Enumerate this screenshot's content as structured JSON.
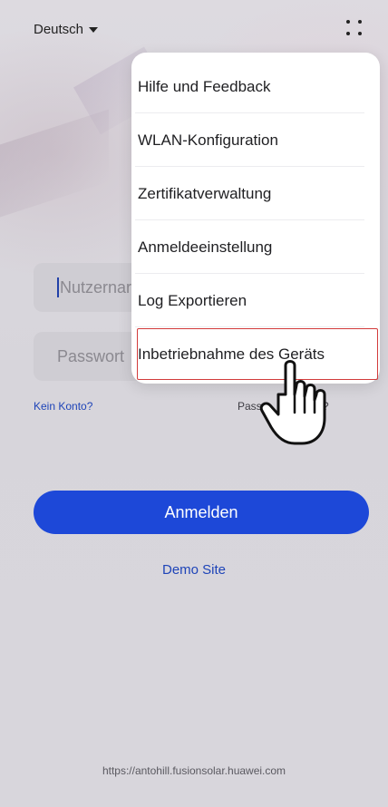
{
  "language": {
    "label": "Deutsch",
    "icon": "caret-down-icon"
  },
  "overflow_menu_icon": "more-dots-icon",
  "login": {
    "username_placeholder": "Nutzernar",
    "password_placeholder": "Passwort",
    "no_account_link": "Kein Konto?",
    "forgot_password_link": "Passw        essen?",
    "login_button": "Anmelden",
    "demo_link": "Demo Site"
  },
  "footer": {
    "url": "https://antohill.fusionsolar.huawei.com"
  },
  "menu": {
    "items": [
      {
        "label": "Hilfe und Feedback"
      },
      {
        "label": "WLAN-Konfiguration"
      },
      {
        "label": "Zertifikatverwaltung"
      },
      {
        "label": "Anmeldeeinstellung"
      },
      {
        "label": "Log Exportieren"
      },
      {
        "label": "Inbetriebnahme des Geräts"
      }
    ],
    "highlighted_index": 5,
    "highlight_color": "#d23b3b"
  },
  "colors": {
    "primary": "#1d48d8",
    "link": "#1e44b8"
  },
  "pointer_icon": "pointing-hand-icon"
}
